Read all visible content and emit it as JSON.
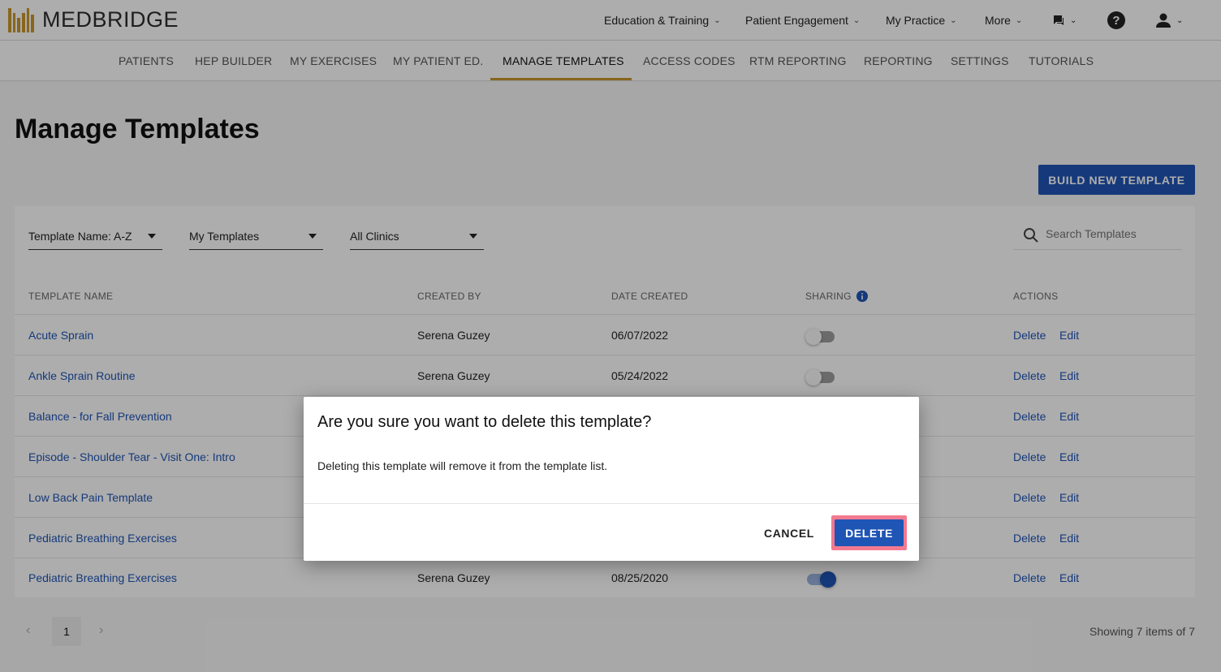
{
  "header": {
    "logo_text": "MEDBRIDGE",
    "nav": [
      {
        "label": "Education & Training"
      },
      {
        "label": "Patient Engagement"
      },
      {
        "label": "My Practice"
      },
      {
        "label": "More"
      }
    ]
  },
  "subnav": {
    "items": [
      {
        "label": "PATIENTS"
      },
      {
        "label": "HEP BUILDER"
      },
      {
        "label": "MY EXERCISES"
      },
      {
        "label": "MY PATIENT ED."
      },
      {
        "label": "MANAGE TEMPLATES"
      },
      {
        "label": "ACCESS CODES"
      },
      {
        "label": "RTM REPORTING"
      },
      {
        "label": "REPORTING"
      },
      {
        "label": "SETTINGS"
      },
      {
        "label": "TUTORIALS"
      }
    ],
    "active": "MANAGE TEMPLATES"
  },
  "page": {
    "title": "Manage Templates",
    "build_button": "BUILD NEW TEMPLATE"
  },
  "filters": {
    "sort": "Template Name: A-Z",
    "ownership": "My Templates",
    "clinic": "All Clinics",
    "search_placeholder": "Search Templates"
  },
  "table": {
    "headers": {
      "name": "TEMPLATE NAME",
      "created_by": "CREATED BY",
      "date": "DATE CREATED",
      "sharing": "SHARING",
      "actions": "ACTIONS"
    },
    "action_delete": "Delete",
    "action_edit": "Edit",
    "rows": [
      {
        "name": "Acute Sprain",
        "created_by": "Serena Guzey",
        "date": "06/07/2022",
        "sharing": false
      },
      {
        "name": "Ankle Sprain Routine",
        "created_by": "Serena Guzey",
        "date": "05/24/2022",
        "sharing": false
      },
      {
        "name": "Balance - for Fall Prevention",
        "created_by": "",
        "date": "",
        "sharing": null
      },
      {
        "name": "Episode - Shoulder Tear - Visit One: Intro",
        "created_by": "",
        "date": "",
        "sharing": null
      },
      {
        "name": "Low Back Pain Template",
        "created_by": "",
        "date": "",
        "sharing": null
      },
      {
        "name": "Pediatric Breathing Exercises",
        "created_by": "",
        "date": "",
        "sharing": null
      },
      {
        "name": "Pediatric Breathing Exercises",
        "created_by": "Serena Guzey",
        "date": "08/25/2020",
        "sharing": true
      }
    ]
  },
  "pagination": {
    "current_page": "1",
    "summary": "Showing 7 items of 7"
  },
  "modal": {
    "title": "Are you sure you want to delete this template?",
    "body": "Deleting this template will remove it from the template list.",
    "cancel": "CANCEL",
    "confirm": "DELETE"
  },
  "colors": {
    "brand_gold": "#c9972b",
    "primary_blue": "#1f55b5",
    "highlight_pink": "#f3798f"
  }
}
